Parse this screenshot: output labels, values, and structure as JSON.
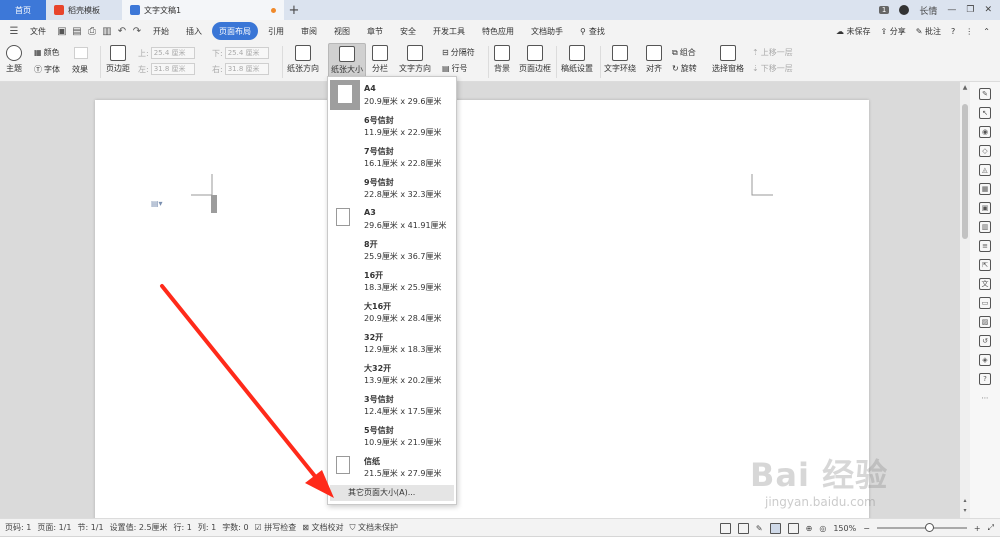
{
  "tabs": {
    "home": "首页",
    "template": "稻壳模板",
    "document": "文字文稿1"
  },
  "titlebar": {
    "badge": "1",
    "user": "长情"
  },
  "menu": {
    "file": "文件",
    "items": [
      "开始",
      "插入",
      "页面布局",
      "引用",
      "审阅",
      "视图",
      "章节",
      "安全",
      "开发工具",
      "特色应用",
      "文档助手"
    ],
    "active_index": 2,
    "search": "查找",
    "unsaved": "未保存",
    "share": "分享",
    "comment": "批注"
  },
  "ribbon": {
    "theme": "主题",
    "color": "颜色",
    "font": "字体",
    "effect": "效果",
    "margins": "页边距",
    "top_label": "上:",
    "top_value": "25.4 厘米",
    "bottom_label": "下:",
    "bottom_value": "25.4 厘米",
    "left_label": "左:",
    "left_value": "31.8 厘米",
    "right_label": "右:",
    "right_value": "31.8 厘米",
    "orientation": "纸张方向",
    "size": "纸张大小",
    "columns": "分栏",
    "text_direction": "文字方向",
    "break": "分隔符",
    "line_numbers": "行号",
    "background": "背景",
    "page_border": "页面边框",
    "manuscript": "稿纸设置",
    "wrap": "文字环绕",
    "align": "对齐",
    "group": "组合",
    "rotate": "旋转",
    "selection_pane": "选择窗格",
    "bring_forward": "上移一层",
    "send_backward": "下移一层"
  },
  "paper_sizes": [
    {
      "name": "A4",
      "dims": "20.9厘米 x 29.6厘米",
      "selected": true
    },
    {
      "name": "6号信封",
      "dims": "11.9厘米 x 22.9厘米"
    },
    {
      "name": "7号信封",
      "dims": "16.1厘米 x 22.8厘米"
    },
    {
      "name": "9号信封",
      "dims": "22.8厘米 x 32.3厘米"
    },
    {
      "name": "A3",
      "dims": "29.6厘米 x 41.91厘米"
    },
    {
      "name": "8开",
      "dims": "25.9厘米 x 36.7厘米"
    },
    {
      "name": "16开",
      "dims": "18.3厘米 x 25.9厘米"
    },
    {
      "name": "大16开",
      "dims": "20.9厘米 x 28.4厘米"
    },
    {
      "name": "32开",
      "dims": "12.9厘米 x 18.3厘米"
    },
    {
      "name": "大32开",
      "dims": "13.9厘米 x 20.2厘米"
    },
    {
      "name": "3号信封",
      "dims": "12.4厘米 x 17.5厘米"
    },
    {
      "name": "5号信封",
      "dims": "10.9厘米 x 21.9厘米"
    },
    {
      "name": "信纸",
      "dims": "21.5厘米 x 27.9厘米"
    }
  ],
  "other_size": "其它页面大小(A)...",
  "status": {
    "page": "页码: 1",
    "pages": "页面: 1/1",
    "section": "节: 1/1",
    "setting": "设置值: 2.5厘米",
    "row": "行: 1",
    "col": "列: 1",
    "words": "字数: 0",
    "spellcheck": "拼写检查",
    "proof": "文档校对",
    "protect": "文档未保护",
    "zoom": "150%"
  },
  "watermark": {
    "brand": "Bai 经验",
    "url": "jingyan.baidu.com"
  },
  "colors": {
    "accent": "#3a76d6",
    "arrow": "#ff2a1a"
  }
}
